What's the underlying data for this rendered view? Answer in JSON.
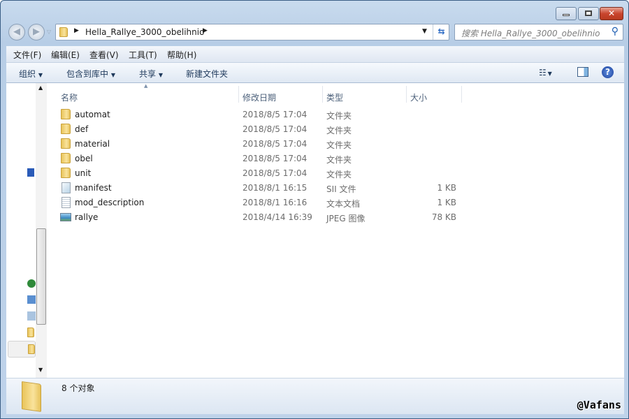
{
  "window": {
    "minimize": "–",
    "maximize": "□",
    "close": "✕"
  },
  "address": {
    "path": "Hella_Rallye_3000_obelihnio",
    "search_placeholder": "搜索 Hella_Rallye_3000_obelihnio"
  },
  "menu": [
    "文件(F)",
    "编辑(E)",
    "查看(V)",
    "工具(T)",
    "帮助(H)"
  ],
  "toolbar": {
    "organize": "组织",
    "include_library": "包含到库中",
    "share": "共享",
    "new_folder": "新建文件夹"
  },
  "columns": {
    "name": "名称",
    "date": "修改日期",
    "type": "类型",
    "size": "大小"
  },
  "files": [
    {
      "name": "automat",
      "date": "2018/8/5 17:04",
      "type": "文件夹",
      "size": "",
      "icon": "folder"
    },
    {
      "name": "def",
      "date": "2018/8/5 17:04",
      "type": "文件夹",
      "size": "",
      "icon": "folder"
    },
    {
      "name": "material",
      "date": "2018/8/5 17:04",
      "type": "文件夹",
      "size": "",
      "icon": "folder"
    },
    {
      "name": "obel",
      "date": "2018/8/5 17:04",
      "type": "文件夹",
      "size": "",
      "icon": "folder"
    },
    {
      "name": "unit",
      "date": "2018/8/5 17:04",
      "type": "文件夹",
      "size": "",
      "icon": "folder"
    },
    {
      "name": "manifest",
      "date": "2018/8/1 16:15",
      "type": "SII 文件",
      "size": "1 KB",
      "icon": "file"
    },
    {
      "name": "mod_description",
      "date": "2018/8/1 16:16",
      "type": "文本文档",
      "size": "1 KB",
      "icon": "text"
    },
    {
      "name": "rallye",
      "date": "2018/4/14 16:39",
      "type": "JPEG 图像",
      "size": "78 KB",
      "icon": "image"
    }
  ],
  "status": {
    "count": "8 个对象"
  },
  "watermark": "@Vafans"
}
